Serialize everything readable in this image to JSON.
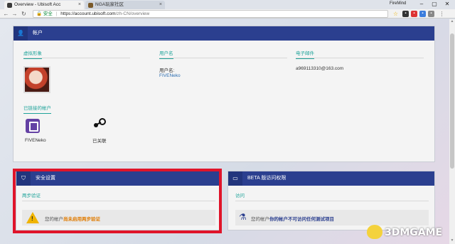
{
  "browser": {
    "tabs": [
      {
        "title": "Overview - Ubisoft Acc",
        "active": true
      },
      {
        "title": "NGA玩家社区",
        "active": false
      }
    ],
    "user": "FireMind",
    "address": {
      "secure_label": "安全",
      "host": "https://account.ubisoft.com",
      "path": "/zh-CN/overview"
    }
  },
  "account": {
    "header": "帐户",
    "avatar_label": "虚拟形象",
    "username_label": "用户名",
    "username_field_label": "用户名:",
    "username": "FIVENeko",
    "email_label": "电子邮件",
    "email": "a969113310@163.com",
    "linked_label": "已链接的帐户",
    "linked": [
      {
        "name": "FIVENeko",
        "icon": "twitch-icon"
      },
      {
        "name": "已关联",
        "icon": "steam-icon"
      }
    ]
  },
  "security": {
    "header": "安全设置",
    "section_label": "两步验证",
    "msg_prefix": "您的帐户",
    "msg_highlight": "尚未启用两步验证"
  },
  "beta": {
    "header": "BETA 版访问权限",
    "section_label": "访问",
    "msg_prefix": "您的帐户",
    "msg_highlight": "你的帐户不可访问任何测试项目"
  },
  "watermark": "3DMGAME",
  "colors": {
    "header_blue": "#2b3f8f",
    "teal": "#1fa39a",
    "highlight_red": "#e0142a",
    "warning_orange": "#e07b00"
  }
}
